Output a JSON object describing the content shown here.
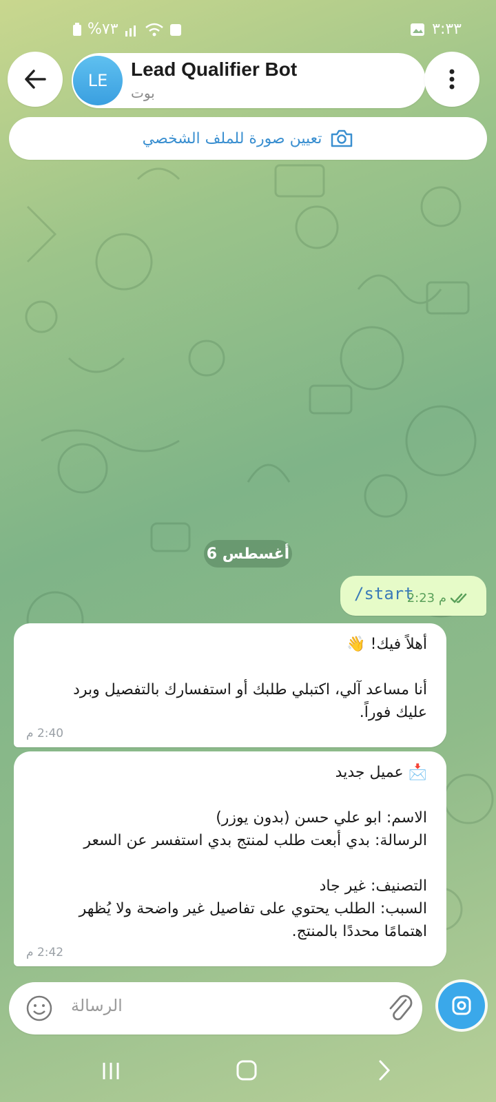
{
  "status_bar": {
    "battery": "%٧٣",
    "time": "٣:٣٣"
  },
  "header": {
    "avatar_initials": "LE",
    "bot_name": "Lead Qualifier Bot",
    "bot_status": "بوت"
  },
  "profile_banner": {
    "label": "تعيين صورة للملف الشخصي"
  },
  "chat": {
    "date_chip": "6 أغسطس",
    "outgoing": {
      "text": "/start",
      "time": "2:23 م"
    },
    "incoming": [
      {
        "text": "أهلاً فيك! 👋\n\nأنا مساعد آلي، اكتبلي طلبك أو استفسارك بالتفصيل وبرد\nعليك فوراً.",
        "time": "2:40 م"
      },
      {
        "text": "📩 عميل جديد\n\nالاسم: ابو علي حسن (بدون يوزر)\nالرسالة: بدي أبعت طلب لمنتج بدي استفسر عن السعر\n\nالتصنيف: غير جاد\nالسبب: الطلب يحتوي على تفاصيل غير واضحة ولا يُظهر\nاهتمامًا محددًا بالمنتج.",
        "time": "2:42 م"
      }
    ]
  },
  "input": {
    "placeholder": "الرسالة"
  },
  "colors": {
    "accent": "#3aa8ea",
    "outgoing_bubble": "#e6fbc8",
    "link": "#3a8fd0"
  }
}
